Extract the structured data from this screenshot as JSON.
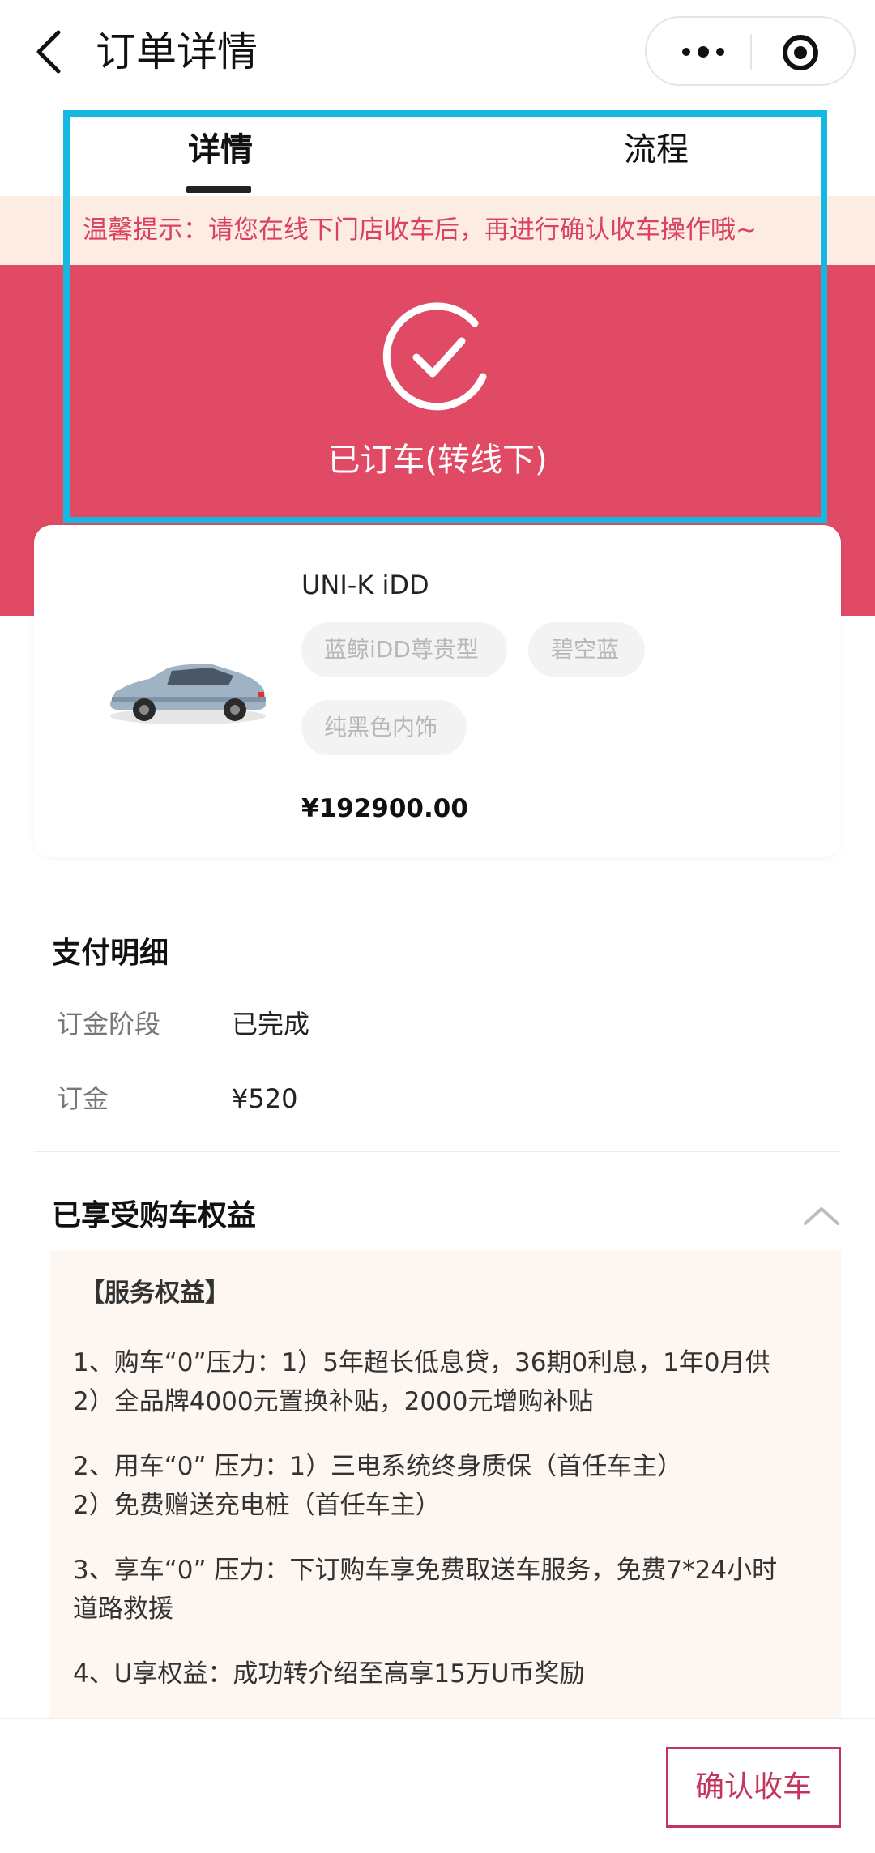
{
  "header": {
    "title": "订单详情"
  },
  "tabs": [
    {
      "label": "详情"
    },
    {
      "label": "流程"
    }
  ],
  "notice": {
    "text": "温馨提示：请您在线下门店收车后，再进行确认收车操作哦~"
  },
  "status": {
    "text": "已订车(转线下)"
  },
  "product": {
    "name": "UNI-K iDD",
    "tags": [
      "蓝鲸iDD尊贵型",
      "碧空蓝",
      "纯黑色内饰"
    ],
    "price": "¥192900.00"
  },
  "payment": {
    "title": "支付明细",
    "rows": [
      {
        "label": "订金阶段",
        "value": "已完成"
      },
      {
        "label": "订金",
        "value": "¥520"
      }
    ]
  },
  "benefits": {
    "title": "已享受购车权益",
    "heading": "【服务权益】",
    "lines": [
      "1、购车“0”压力：1）5年超长低息贷，36期0利息，1年0月供",
      "2）全品牌4000元置换补贴，2000元增购补贴",
      "2、用车“0” 压力：1）三电系统终身质保（首任车主）",
      "2）免费赠送充电桩（首任车主）",
      "3、享车“0” 压力：下订购车享免费取送车服务，免费7*24小时",
      "道路救援",
      "4、U享权益：成功转介绍至高享15万U币奖励"
    ]
  },
  "footer": {
    "confirm_label": "确认收车"
  },
  "colors": {
    "status_band": "#e04a64",
    "notice_bg": "#fdece3",
    "notice_text": "#d9435f",
    "highlight": "#14b8e0",
    "confirm_accent": "#c2365d"
  },
  "icons": {
    "back": "chevron-left-icon",
    "more": "more-dots-icon",
    "close": "target-circle-icon",
    "status": "check-circle-icon",
    "collapse": "chevron-up-icon"
  }
}
